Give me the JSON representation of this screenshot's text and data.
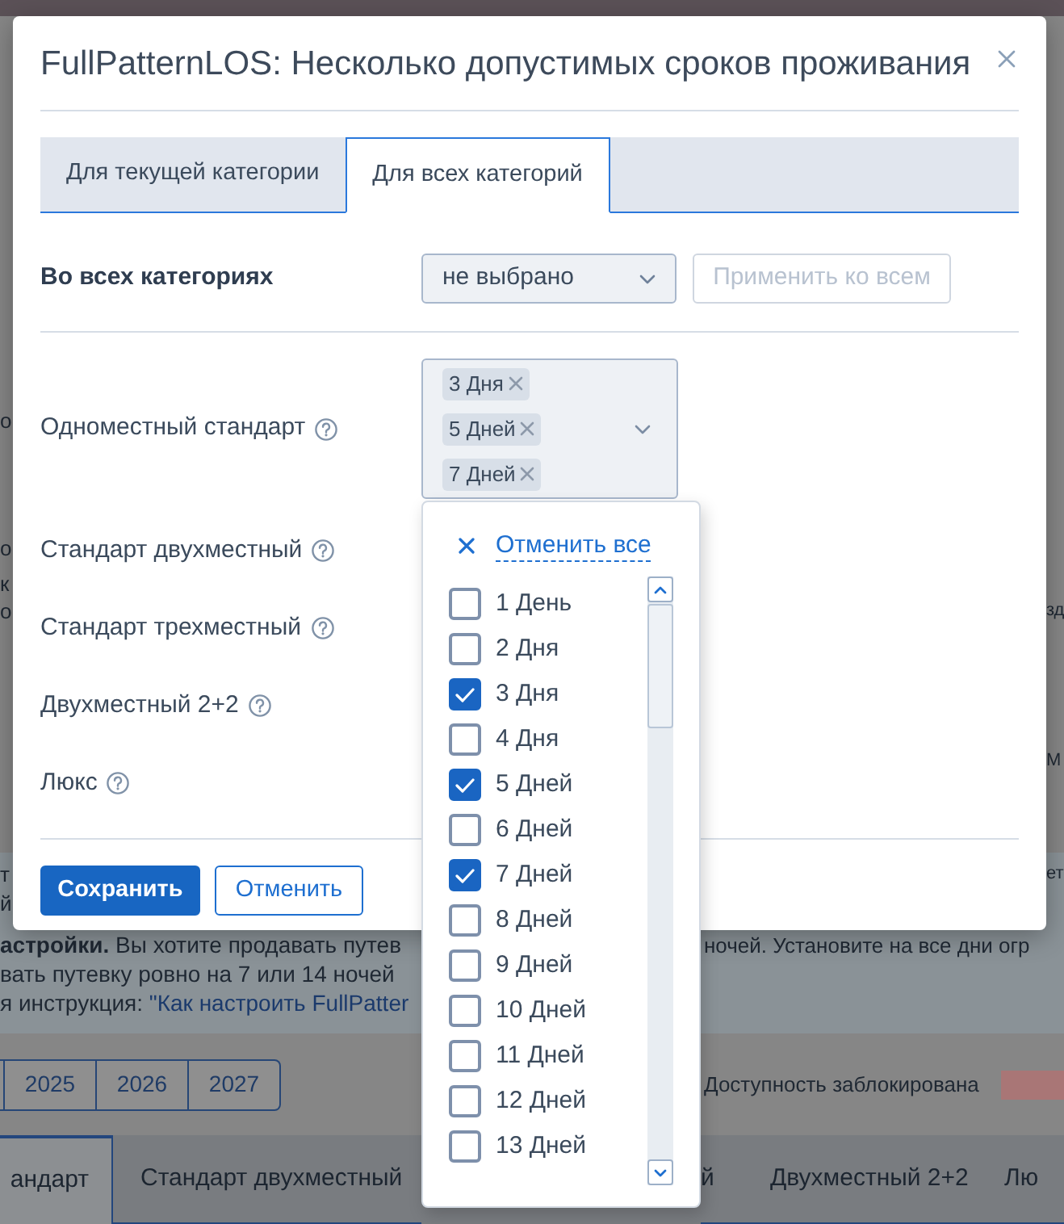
{
  "page_behind": {
    "edge_fragments": [
      {
        "left": "о"
      },
      {
        "left": "о"
      },
      {
        "left": "к"
      },
      {
        "left": "о",
        "right": "зд"
      },
      {
        "right": "М"
      }
    ],
    "info": {
      "fragments": [
        {
          "left": "т",
          "right": "ет"
        },
        {
          "left": "й"
        }
      ],
      "lines": [
        {
          "left": "**астройки.** Вы хотите продавать путев",
          "right": "ночей. Установите на все дни огр"
        },
        {
          "left": "вать путевку ровно на 7 или 14 ночей"
        },
        {
          "left": "я инструкция: ",
          "link": "\"Как настроить FullPatter"
        }
      ]
    },
    "years": [
      "2025",
      "2026",
      "2027"
    ],
    "legend": {
      "label": "Доступность заблокирована"
    },
    "tabs": [
      {
        "label": "андарт",
        "selected": true
      },
      {
        "label": "Стандарт двухместный",
        "selected": false
      },
      {
        "label": "й",
        "selected": false
      },
      {
        "label": "Двухместный 2+2",
        "selected": false
      },
      {
        "label": "Лю",
        "selected": false
      }
    ]
  },
  "dialog": {
    "title": "FullPatternLOS: Несколько допустимых сроков проживания",
    "tabs": [
      {
        "label": "Для текущей категории",
        "selected": false
      },
      {
        "label": "Для всех категорий",
        "selected": true
      }
    ],
    "all_categories": {
      "label": "Во всех категориях",
      "select": {
        "value": "не выбрано"
      },
      "apply_button": {
        "label": "Применить ко всем",
        "disabled": true
      }
    },
    "categories": [
      {
        "name": "Одноместный стандарт",
        "chips": [
          "3 Дня",
          "5 Дней",
          "7 Дней"
        ]
      },
      {
        "name": "Стандарт двухместный"
      },
      {
        "name": "Стандарт трехместный"
      },
      {
        "name": "Двухместный 2+2"
      },
      {
        "name": "Люкс"
      }
    ],
    "buttons": [
      {
        "label": "Сохранить",
        "kind": "primary"
      },
      {
        "label": "Отменить",
        "kind": "secondary"
      }
    ]
  },
  "dropdown": {
    "clear_all": "Отменить все",
    "options": [
      {
        "label": "1 День",
        "checked": false
      },
      {
        "label": "2 Дня",
        "checked": false
      },
      {
        "label": "3 Дня",
        "checked": true
      },
      {
        "label": "4 Дня",
        "checked": false
      },
      {
        "label": "5 Дней",
        "checked": true
      },
      {
        "label": "6 Дней",
        "checked": false
      },
      {
        "label": "7 Дней",
        "checked": true
      },
      {
        "label": "8 Дней",
        "checked": false
      },
      {
        "label": "9 Дней",
        "checked": false
      },
      {
        "label": "10 Дней",
        "checked": false
      },
      {
        "label": "11 Дней",
        "checked": false
      },
      {
        "label": "12 Дней",
        "checked": false
      },
      {
        "label": "13 Дней",
        "checked": false
      }
    ]
  }
}
